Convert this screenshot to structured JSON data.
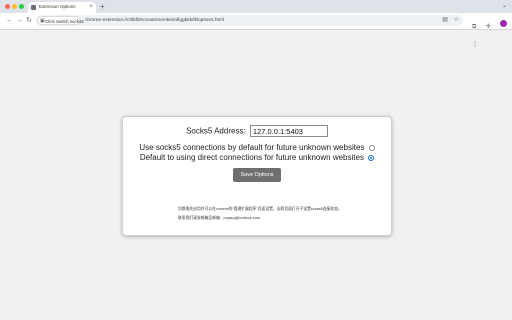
{
  "browser": {
    "tab": {
      "title": "Extension Options",
      "close": "×"
    },
    "new_tab": "+",
    "chip_label": "Click switch socks5",
    "url": "chrome-extension://chlblldncosamnemkeimfiggbkk/lkloptions.html",
    "nav": {
      "back": "←",
      "forward": "→",
      "reload": "↻"
    },
    "icons": [
      "translate-icon",
      "star-icon",
      "extension-icon",
      "profile-avatar",
      "menu-icon"
    ]
  },
  "options": {
    "address_label": "Socks5 Address:",
    "address_value": "127.0.0.1:5403",
    "radio_socks5_label": "Use socks5 connections by default for future unknown websites",
    "radio_socks5_checked": false,
    "radio_direct_label": "Default to using direct connections for future unknown websites",
    "radio_direct_checked": true,
    "save_label": "Save Options",
    "note_1": "切换需先启用并可以在chrome的“管理扩展程序”页面设置，去默页面打开子设置socks5连接状态。",
    "note_2": "联系我们请发邮箱至邮箱：pojasoj@outlook.com"
  }
}
